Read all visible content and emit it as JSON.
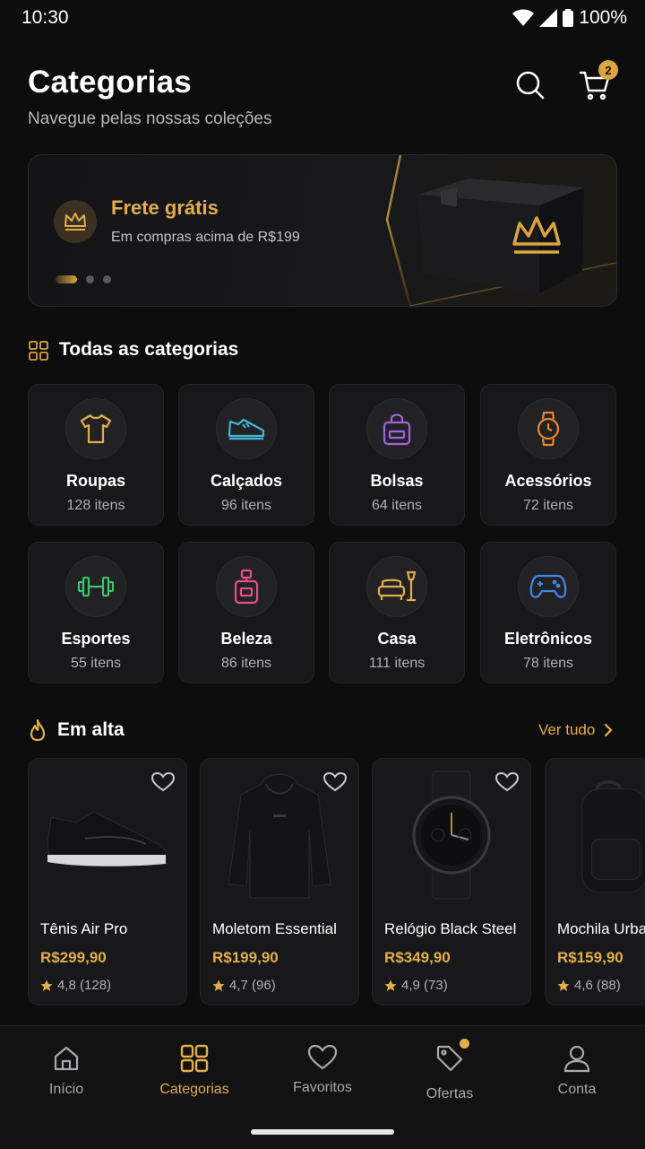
{
  "status_bar": {
    "time": "10:30",
    "battery": "100%"
  },
  "header": {
    "title": "Categorias",
    "subtitle": "Navegue pelas nossas coleções",
    "cart_count": "2"
  },
  "banner": {
    "title": "Frete grátis",
    "subtitle": "Em compras acima de R$199",
    "slides": 3,
    "active_slide": 1
  },
  "categories_section": {
    "title": "Todas as categorias",
    "items": [
      {
        "name": "Roupas",
        "count": "128 itens",
        "icon": "tshirt-icon",
        "color": "#e2ad4c"
      },
      {
        "name": "Calçados",
        "count": "96 itens",
        "icon": "sneaker-icon",
        "color": "#3fb8d6"
      },
      {
        "name": "Bolsas",
        "count": "64 itens",
        "icon": "bag-icon",
        "color": "#a461e0"
      },
      {
        "name": "Acessórios",
        "count": "72 itens",
        "icon": "watch-icon",
        "color": "#e9852f"
      },
      {
        "name": "Esportes",
        "count": "55 itens",
        "icon": "dumbbell-icon",
        "color": "#3ec46a"
      },
      {
        "name": "Beleza",
        "count": "86 itens",
        "icon": "perfume-icon",
        "color": "#e84f88"
      },
      {
        "name": "Casa",
        "count": "111 itens",
        "icon": "sofa-lamp-icon",
        "color": "#e2ad4c"
      },
      {
        "name": "Eletrônicos",
        "count": "78 itens",
        "icon": "gamepad-icon",
        "color": "#3f86ea"
      }
    ]
  },
  "trending": {
    "title": "Em alta",
    "see_all": "Ver tudo",
    "products": [
      {
        "name": "Tênis Air Pro",
        "price": "R$299,90",
        "rating": "4,8 (128)",
        "image": "sneaker-image"
      },
      {
        "name": "Moletom Essential",
        "price": "R$199,90",
        "rating": "4,7 (96)",
        "image": "hoodie-image"
      },
      {
        "name": "Relógio Black Steel",
        "price": "R$349,90",
        "rating": "4,9 (73)",
        "image": "watch-image"
      },
      {
        "name": "Mochila Urba",
        "price": "R$159,90",
        "rating": "4,6 (88)",
        "image": "backpack-image"
      }
    ]
  },
  "bottom_nav": {
    "items": [
      {
        "label": "Início",
        "icon": "home-icon",
        "active": false
      },
      {
        "label": "Categorias",
        "icon": "grid-icon",
        "active": true
      },
      {
        "label": "Favoritos",
        "icon": "heart-icon",
        "active": false
      },
      {
        "label": "Ofertas",
        "icon": "tag-icon",
        "active": false
      },
      {
        "label": "Conta",
        "icon": "user-icon",
        "active": false
      }
    ]
  },
  "colors": {
    "accent": "#e2ad4c",
    "background": "#0d0d0e",
    "card": "#18181a"
  }
}
